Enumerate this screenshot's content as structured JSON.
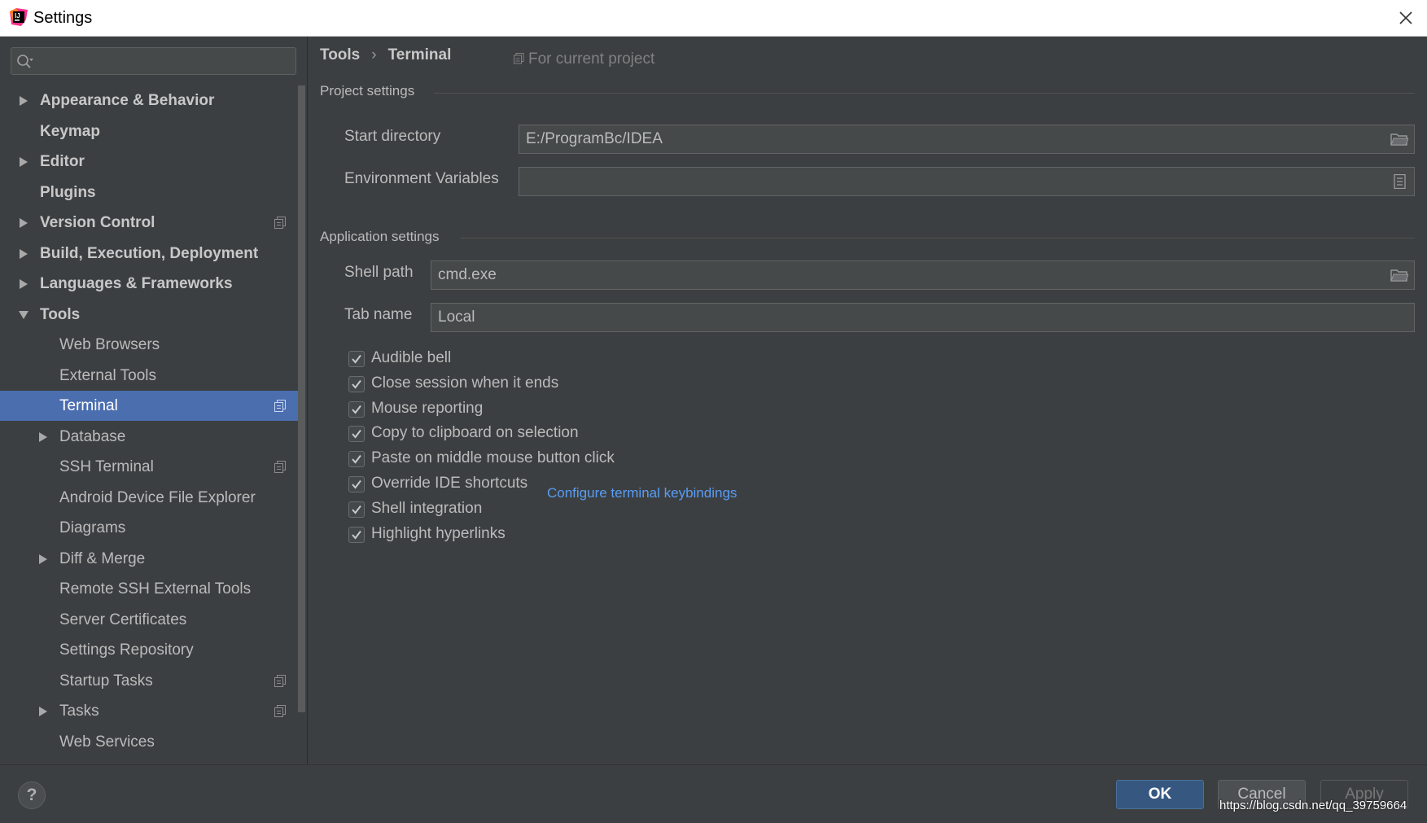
{
  "window": {
    "title": "Settings",
    "app_icon": "intellij-icon",
    "close_icon": "close-icon"
  },
  "search": {
    "value": "",
    "placeholder": ""
  },
  "sidebar": {
    "items": [
      {
        "label": "Appearance & Behavior",
        "arrow": "collapsed",
        "level": 0,
        "bold": true,
        "project": false
      },
      {
        "label": "Keymap",
        "arrow": "none",
        "level": 0,
        "bold": true,
        "project": false
      },
      {
        "label": "Editor",
        "arrow": "collapsed",
        "level": 0,
        "bold": true,
        "project": false
      },
      {
        "label": "Plugins",
        "arrow": "none",
        "level": 0,
        "bold": true,
        "project": false
      },
      {
        "label": "Version Control",
        "arrow": "collapsed",
        "level": 0,
        "bold": true,
        "project": true
      },
      {
        "label": "Build, Execution, Deployment",
        "arrow": "collapsed",
        "level": 0,
        "bold": true,
        "project": false
      },
      {
        "label": "Languages & Frameworks",
        "arrow": "collapsed",
        "level": 0,
        "bold": true,
        "project": false
      },
      {
        "label": "Tools",
        "arrow": "expanded",
        "level": 0,
        "bold": true,
        "project": false
      },
      {
        "label": "Web Browsers",
        "arrow": "none",
        "level": 1,
        "bold": false,
        "project": false
      },
      {
        "label": "External Tools",
        "arrow": "none",
        "level": 1,
        "bold": false,
        "project": false
      },
      {
        "label": "Terminal",
        "arrow": "none",
        "level": 1,
        "bold": false,
        "project": true,
        "selected": true
      },
      {
        "label": "Database",
        "arrow": "collapsed",
        "level": 1,
        "bold": false,
        "project": false
      },
      {
        "label": "SSH Terminal",
        "arrow": "none",
        "level": 1,
        "bold": false,
        "project": true
      },
      {
        "label": "Android Device File Explorer",
        "arrow": "none",
        "level": 1,
        "bold": false,
        "project": false
      },
      {
        "label": "Diagrams",
        "arrow": "none",
        "level": 1,
        "bold": false,
        "project": false
      },
      {
        "label": "Diff & Merge",
        "arrow": "collapsed",
        "level": 1,
        "bold": false,
        "project": false
      },
      {
        "label": "Remote SSH External Tools",
        "arrow": "none",
        "level": 1,
        "bold": false,
        "project": false
      },
      {
        "label": "Server Certificates",
        "arrow": "none",
        "level": 1,
        "bold": false,
        "project": false
      },
      {
        "label": "Settings Repository",
        "arrow": "none",
        "level": 1,
        "bold": false,
        "project": false
      },
      {
        "label": "Startup Tasks",
        "arrow": "none",
        "level": 1,
        "bold": false,
        "project": true
      },
      {
        "label": "Tasks",
        "arrow": "collapsed",
        "level": 1,
        "bold": false,
        "project": true
      },
      {
        "label": "Web Services",
        "arrow": "none",
        "level": 1,
        "bold": false,
        "project": false
      }
    ]
  },
  "header": {
    "breadcrumb": [
      "Tools",
      "Terminal"
    ],
    "separator": "›",
    "for_current_project": "For current project"
  },
  "project_settings": {
    "title": "Project settings",
    "start_directory_label": "Start directory",
    "start_directory_value": "E:/ProgramBc/IDEA",
    "env_vars_label": "Environment Variables",
    "env_vars_value": ""
  },
  "application_settings": {
    "title": "Application settings",
    "shell_path_label": "Shell path",
    "shell_path_value": "cmd.exe",
    "tab_name_label": "Tab name",
    "tab_name_value": "Local",
    "checkboxes": [
      {
        "label": "Audible bell",
        "checked": true
      },
      {
        "label": "Close session when it ends",
        "checked": true
      },
      {
        "label": "Mouse reporting",
        "checked": true
      },
      {
        "label": "Copy to clipboard on selection",
        "checked": true
      },
      {
        "label": "Paste on middle mouse button click",
        "checked": true
      },
      {
        "label": "Override IDE shortcuts",
        "checked": true
      },
      {
        "label": "Shell integration",
        "checked": true
      },
      {
        "label": "Highlight hyperlinks",
        "checked": true
      }
    ],
    "keybindings_link": "Configure terminal keybindings"
  },
  "footer": {
    "help": "?",
    "ok": "OK",
    "cancel": "Cancel",
    "apply": "Apply",
    "watermark": "https://blog.csdn.net/qq_39759664"
  },
  "colors": {
    "background": "#3c3f41",
    "selection": "#4b6eaf",
    "ok_button": "#365880",
    "link": "#589df6"
  }
}
